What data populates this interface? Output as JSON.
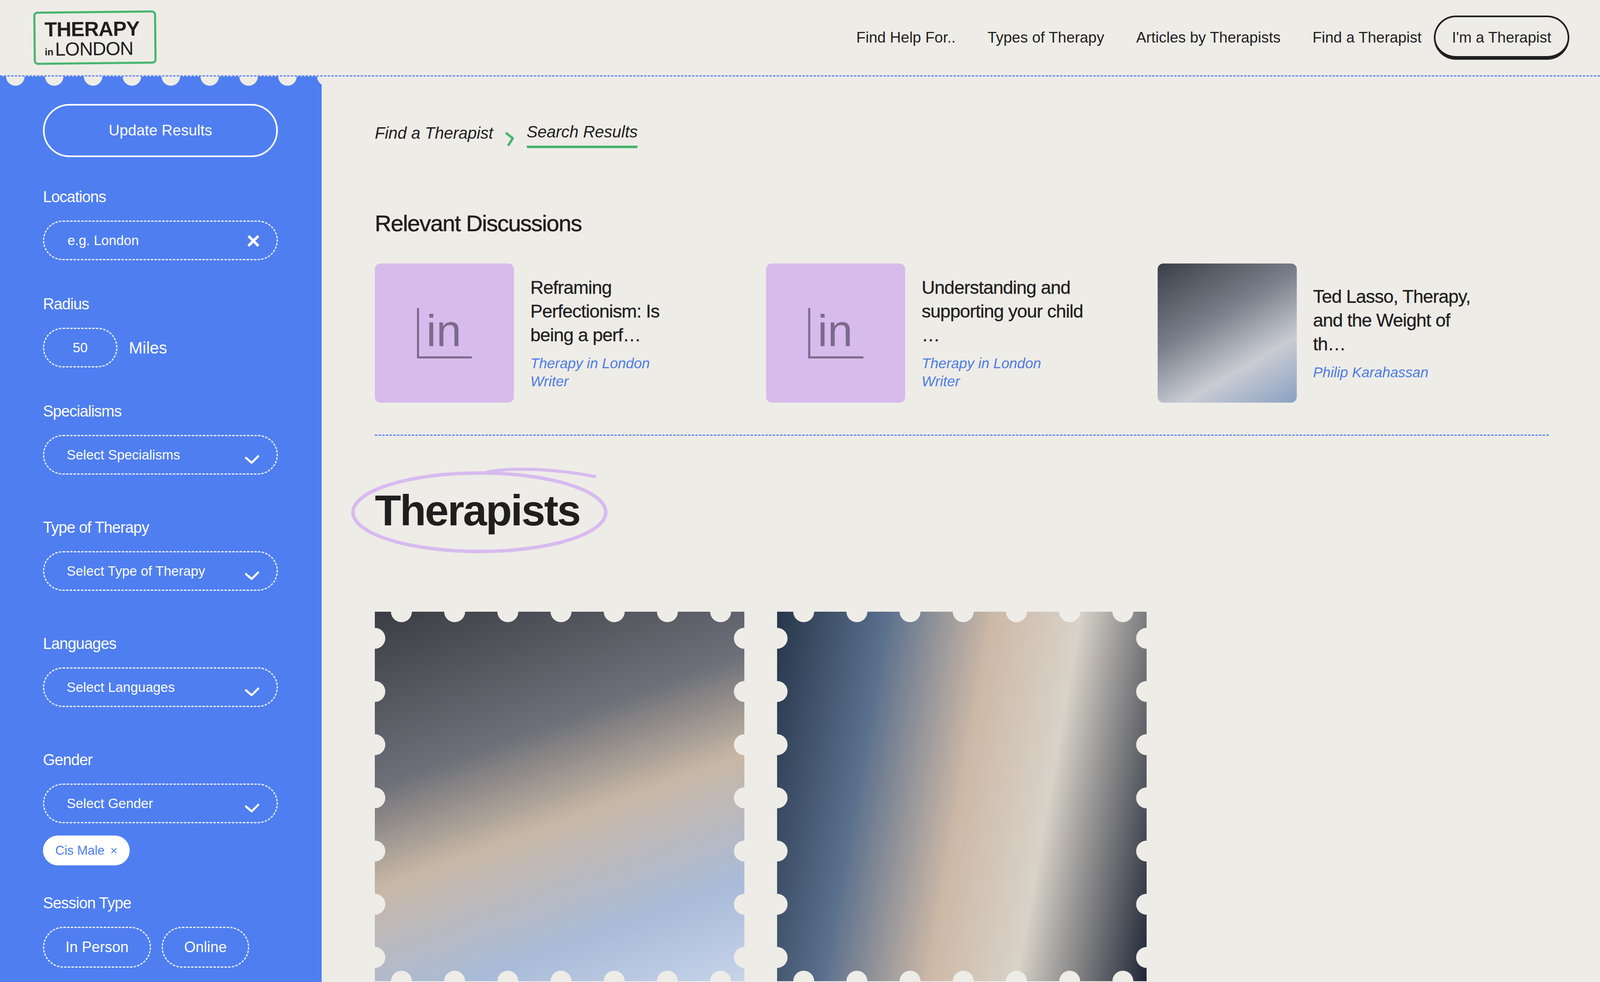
{
  "header": {
    "logo": {
      "line1": "THERAPY",
      "small": "in",
      "line2": "LONDON"
    },
    "nav": [
      "Find Help For..",
      "Types of Therapy",
      "Articles by Therapists",
      "Find a Therapist"
    ],
    "cta": "I'm a Therapist"
  },
  "sidebar": {
    "update": "Update Results",
    "filters": [
      {
        "kind": "text",
        "label": "Locations",
        "placeholder": "e.g. London",
        "clear": "×"
      },
      {
        "kind": "number",
        "label": "Radius",
        "value": "50",
        "unit": "Miles"
      },
      {
        "kind": "select",
        "label": "Specialisms",
        "placeholder": "Select Specialisms",
        "chips": []
      },
      {
        "kind": "select",
        "label": "Type of Therapy",
        "placeholder": "Select Type of Therapy",
        "chips": []
      },
      {
        "kind": "select",
        "label": "Languages",
        "placeholder": "Select Languages",
        "chips": []
      },
      {
        "kind": "select",
        "label": "Gender",
        "placeholder": "Select Gender",
        "chips": [
          {
            "label": "Cis Male",
            "remove": "×"
          }
        ]
      },
      {
        "kind": "toggle",
        "label": "Session Type",
        "options": [
          {
            "label": "In Person",
            "selected": false
          },
          {
            "label": "Online",
            "selected": false
          }
        ]
      }
    ]
  },
  "breadcrumb": [
    {
      "label": "Find a Therapist",
      "selected": false
    },
    {
      "label": "Search Results",
      "selected": true
    }
  ],
  "discussions": {
    "title": "Relevant Discussions",
    "items": [
      {
        "title": "Reframing Perfectionism: Is being a perf…",
        "author": "Therapy in London Writer",
        "thumb": {
          "kind": "logo",
          "text": "in"
        }
      },
      {
        "title": "Understanding and supporting your child …",
        "author": "Therapy in London Writer",
        "thumb": {
          "kind": "logo",
          "text": "in"
        }
      },
      {
        "title": "Ted Lasso, Therapy, and the Weight of th…",
        "author": "Philip Karahassan",
        "thumb": {
          "kind": "photo"
        }
      }
    ]
  },
  "therapists": {
    "title": "Therapists",
    "cards": [
      {
        "kind": "photo"
      },
      {
        "kind": "photo"
      }
    ]
  }
}
